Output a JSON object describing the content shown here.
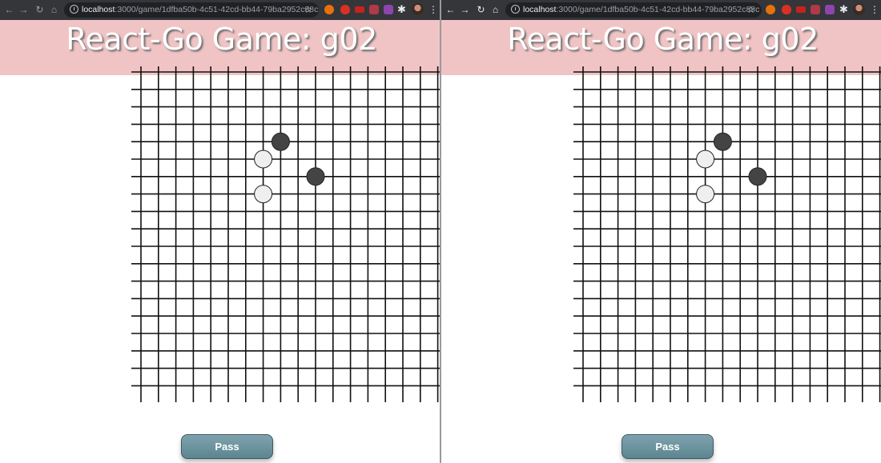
{
  "windows": [
    {
      "browser": {
        "url_host": "localhost",
        "url_path": ":3000/game/1dfba50b-4c51-42cd-bb44-79ba2952c88c",
        "nav_icons": [
          "back-arrow-icon",
          "forward-arrow-icon",
          "reload-icon",
          "home-icon"
        ],
        "extensions": [
          "extension-icon-1",
          "extension-icon-2",
          "extension-icon-3",
          "extension-icon-4",
          "extension-icon-5"
        ]
      },
      "game": {
        "title": "React-Go Game: g02",
        "pass_label": "Pass",
        "stones": [
          {
            "color": "black",
            "col": 8,
            "row": 4
          },
          {
            "color": "white",
            "col": 7,
            "row": 5
          },
          {
            "color": "black",
            "col": 10,
            "row": 6
          },
          {
            "color": "white",
            "col": 7,
            "row": 7
          }
        ]
      }
    },
    {
      "browser": {
        "url_host": "localhost",
        "url_path": ":3000/game/1dfba50b-4c51-42cd-bb44-79ba2952c88c",
        "nav_icons": [
          "back-arrow-icon",
          "forward-arrow-icon",
          "reload-icon",
          "home-icon"
        ],
        "extensions": [
          "extension-icon-1",
          "extension-icon-2",
          "extension-icon-3",
          "extension-icon-4",
          "extension-icon-5"
        ]
      },
      "game": {
        "title": "React-Go Game: g02",
        "pass_label": "Pass",
        "stones": [
          {
            "color": "black",
            "col": 8,
            "row": 4
          },
          {
            "color": "white",
            "col": 7,
            "row": 5
          },
          {
            "color": "black",
            "col": 10,
            "row": 6
          },
          {
            "color": "white",
            "col": 7,
            "row": 7
          }
        ]
      }
    }
  ],
  "colors": {
    "header_bg": "#f0c4c5",
    "black_stone": "#444444",
    "white_stone": "#efefef",
    "pass_button": "#6b929d"
  }
}
